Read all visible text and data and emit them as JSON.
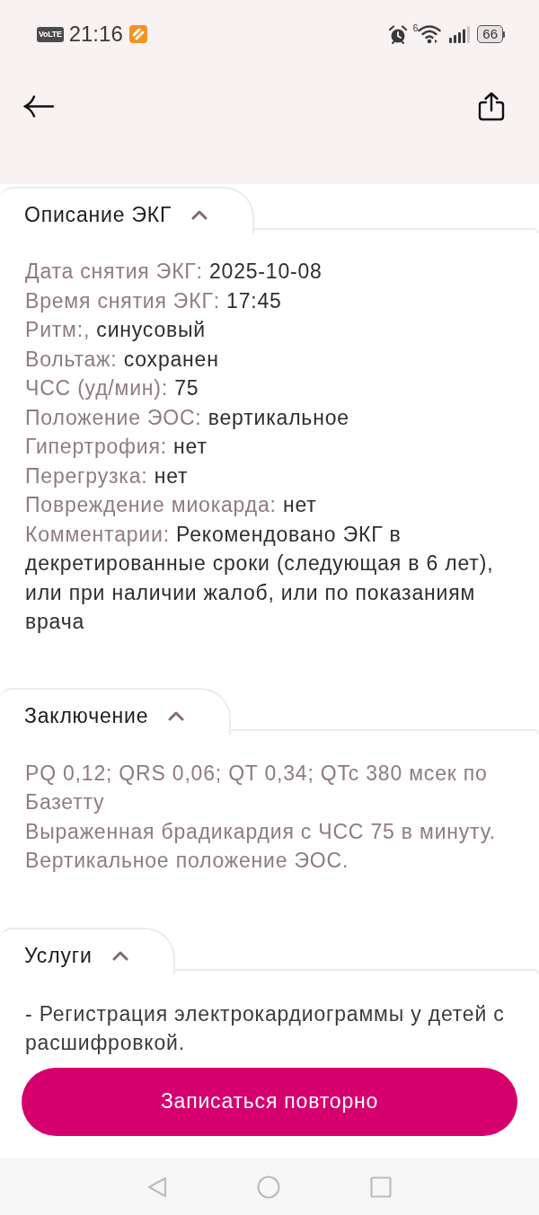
{
  "status_bar": {
    "network": "VoLTE",
    "time": "21:16",
    "wifi_standard": "6",
    "battery": "66"
  },
  "sections": [
    {
      "title": "Описание ЭКГ",
      "expanded": true,
      "kind": "fields",
      "fields": [
        {
          "label": "Дата снятия ЭКГ:",
          "value": "2025-10-08"
        },
        {
          "label": "Время снятия ЭКГ:",
          "value": "17:45"
        },
        {
          "label": "Ритм:,",
          "value": "синусовый"
        },
        {
          "label": "Вольтаж:",
          "value": "сохранен"
        },
        {
          "label": "ЧСС (уд/мин):",
          "value": "75"
        },
        {
          "label": "Положение ЭОС:",
          "value": "вертикальное"
        },
        {
          "label": "Гипертрофия:",
          "value": "нет"
        },
        {
          "label": "Перегрузка:",
          "value": "нет"
        },
        {
          "label": "Повреждение миокарда:",
          "value": "нет"
        },
        {
          "label": "Комментарии:",
          "value": "Рекомендовано ЭКГ в декретированные сроки (следующая в 6 лет), или при наличии жалоб, или по показаниям врача"
        }
      ]
    },
    {
      "title": "Заключение",
      "expanded": true,
      "kind": "conclusion",
      "lines": [
        "PQ 0,12; QRS 0,06; QT 0,34; QTc 380 мсек по Базетту",
        "Выраженная брадикардия с ЧСС 75 в минуту.",
        "Вертикальное положение ЭОС."
      ]
    },
    {
      "title": "Услуги",
      "expanded": true,
      "kind": "services",
      "lines": [
        "- Регистрация электрокардиограммы у детей с расшифровкой."
      ]
    }
  ],
  "primary_button": "Записаться повторно"
}
